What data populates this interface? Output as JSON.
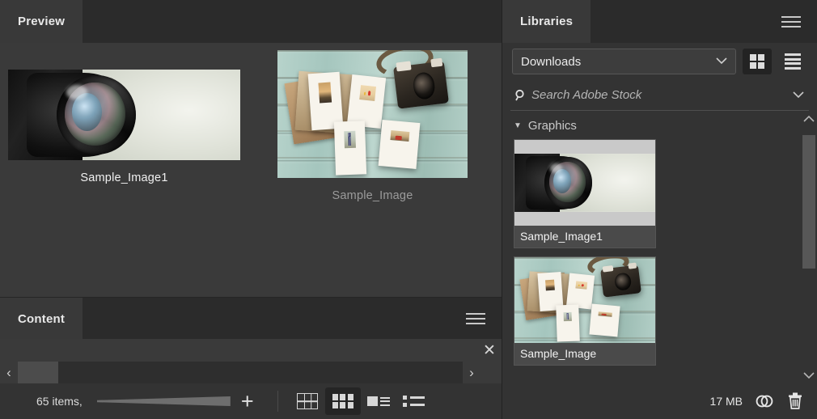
{
  "left_panel": {
    "tabs": [
      {
        "label": "Preview",
        "active": true
      }
    ],
    "previews": [
      {
        "label": "Sample_Image1",
        "art": "camera-lens",
        "dim_label": false
      },
      {
        "label": "Sample_Image",
        "art": "polaroids-wood",
        "dim_label": true
      }
    ]
  },
  "content_panel": {
    "tabs": [
      {
        "label": "Content",
        "active": true
      }
    ],
    "close_label": "✕",
    "path_prev_label": "‹",
    "path_next_label": "›",
    "item_count": "65 items,",
    "add_label": "+",
    "view_modes": [
      {
        "name": "grid-view",
        "active": false
      },
      {
        "name": "thumbnail-view",
        "active": true
      },
      {
        "name": "details-view",
        "active": false
      },
      {
        "name": "list-view",
        "active": false
      }
    ]
  },
  "libraries_panel": {
    "tabs": [
      {
        "label": "Libraries",
        "active": true
      }
    ],
    "library_select": {
      "value": "Downloads",
      "chevron": "⌄"
    },
    "view_toggles": [
      {
        "name": "grid-view-toggle",
        "active": true
      },
      {
        "name": "list-view-toggle",
        "active": false
      }
    ],
    "search": {
      "placeholder": "Search Adobe Stock",
      "value": "",
      "chevron": "⌄"
    },
    "groups": [
      {
        "label": "Graphics",
        "expanded": true,
        "caret": "▼",
        "assets": [
          {
            "name": "Sample_Image1",
            "art": "camera-lens"
          },
          {
            "name": "Sample_Image",
            "art": "polaroids-wood"
          }
        ]
      }
    ],
    "scrollbar": {
      "up_arrow": "⌃",
      "down_arrow": "⌄"
    },
    "footer": {
      "size": "17 MB",
      "cc_icon": "creative-cloud-icon",
      "delete_icon": "trash-icon"
    }
  },
  "colors": {
    "panel_bg": "#333333",
    "tabbar_bg": "#2b2b2b",
    "active_tab_bg": "#393939",
    "preview_bg": "#3a3a3a",
    "text": "#e8e8e8",
    "muted_text": "#9b9b9b",
    "accent_selected": "#252525"
  }
}
